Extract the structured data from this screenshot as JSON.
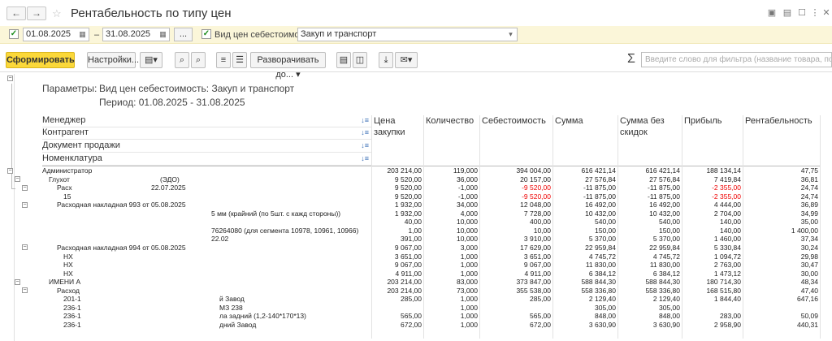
{
  "window": {
    "title": "Рентабельность по типу цен"
  },
  "filters": {
    "date_from": "01.08.2025",
    "date_sep": "–",
    "date_to": "31.08.2025",
    "ellipsis": "...",
    "cost_type_label": "Вид цен себестоимость:",
    "cost_type_value": "Закуп и транспорт"
  },
  "toolbar": {
    "generate": "Сформировать",
    "settings": "Настройки...",
    "expand": "Разворачивать до...",
    "search_placeholder": "Введите слово для фильтра (название товара, покупателя)"
  },
  "report": {
    "params_label": "Параметры:",
    "param_cost": "Вид цен себестоимость: Закуп и транспорт",
    "param_period": "Период: 01.08.2025 - 31.08.2025",
    "group_headers": [
      "Менеджер",
      "Контрагент",
      "Документ продажи",
      "Номенклатура"
    ],
    "columns": {
      "price": "Цена закупки",
      "qty": "Количество",
      "cost": "Себестоимость",
      "sum": "Сумма",
      "sum_no_disc": "Сумма без скидок",
      "profit": "Прибыль",
      "margin": "Рентабельность"
    },
    "rows": [
      {
        "name": "Администратор",
        "price": "203 214,00",
        "qty": "119,000",
        "cost": "394 004,00",
        "sum": "616 421,14",
        "sum_nd": "616 421,14",
        "profit": "188 134,14",
        "margin": "47,75"
      },
      {
        "name": "Глухот",
        "price": "9 520,00",
        "qty": "36,000",
        "cost": "20 157,00",
        "sum": "27 576,84",
        "sum_nd": "27 576,84",
        "profit": "7 419,84",
        "margin": "36,81"
      },
      {
        "name": "Расх",
        "price": "9 520,00",
        "qty": "-1,000",
        "cost": "-9 520,00",
        "sum": "-11 875,00",
        "sum_nd": "-11 875,00",
        "profit": "-2 355,00",
        "margin": "24,74"
      },
      {
        "name": "15",
        "price": "9 520,00",
        "qty": "-1,000",
        "cost": "-9 520,00",
        "sum": "-11 875,00",
        "sum_nd": "-11 875,00",
        "profit": "-2 355,00",
        "margin": "24,74"
      },
      {
        "name": "Расходная накладная 993 от 05.08.2025",
        "price": "1 932,00",
        "qty": "34,000",
        "cost": "12 048,00",
        "sum": "16 492,00",
        "sum_nd": "16 492,00",
        "profit": "4 444,00",
        "margin": "36,89"
      },
      {
        "name": "5 мм (крайний (по 5шт. с кажд стороны))",
        "price": "1 932,00",
        "qty": "4,000",
        "cost": "7 728,00",
        "sum": "10 432,00",
        "sum_nd": "10 432,00",
        "profit": "2 704,00",
        "margin": "34,99"
      },
      {
        "name": "",
        "price": "40,00",
        "qty": "10,000",
        "cost": "400,00",
        "sum": "540,00",
        "sum_nd": "540,00",
        "profit": "140,00",
        "margin": "35,00"
      },
      {
        "name": "76264080 (для сегмента 10978, 10961, 10966)",
        "price": "1,00",
        "qty": "10,000",
        "cost": "10,00",
        "sum": "150,00",
        "sum_nd": "150,00",
        "profit": "140,00",
        "margin": "1 400,00"
      },
      {
        "name": "22.02",
        "price": "391,00",
        "qty": "10,000",
        "cost": "3 910,00",
        "sum": "5 370,00",
        "sum_nd": "5 370,00",
        "profit": "1 460,00",
        "margin": "37,34"
      },
      {
        "name": "Расходная накладная 994 от 05.08.2025",
        "price": "9 067,00",
        "qty": "3,000",
        "cost": "17 629,00",
        "sum": "22 959,84",
        "sum_nd": "22 959,84",
        "profit": "5 330,84",
        "margin": "30,24"
      },
      {
        "name": "НХ",
        "price": "3 651,00",
        "qty": "1,000",
        "cost": "3 651,00",
        "sum": "4 745,72",
        "sum_nd": "4 745,72",
        "profit": "1 094,72",
        "margin": "29,98"
      },
      {
        "name": "НХ",
        "price": "9 067,00",
        "qty": "1,000",
        "cost": "9 067,00",
        "sum": "11 830,00",
        "sum_nd": "11 830,00",
        "profit": "2 763,00",
        "margin": "30,47"
      },
      {
        "name": "НХ",
        "price": "4 911,00",
        "qty": "1,000",
        "cost": "4 911,00",
        "sum": "6 384,12",
        "sum_nd": "6 384,12",
        "profit": "1 473,12",
        "margin": "30,00"
      },
      {
        "name": "ИМЕНИ А",
        "price": "203 214,00",
        "qty": "83,000",
        "cost": "373 847,00",
        "sum": "588 844,30",
        "sum_nd": "588 844,30",
        "profit": "180 714,30",
        "margin": "48,34"
      },
      {
        "name": "Расход",
        "price": "203 214,00",
        "qty": "73,000",
        "cost": "355 538,00",
        "sum": "558 336,80",
        "sum_nd": "558 336,80",
        "profit": "168 515,80",
        "margin": "47,40"
      },
      {
        "name": "201-1",
        "price": "285,00",
        "qty": "1,000",
        "cost": "285,00",
        "sum": "2 129,40",
        "sum_nd": "2 129,40",
        "profit": "1 844,40",
        "margin": "647,16"
      },
      {
        "name": "236-1",
        "price": "",
        "qty": "1,000",
        "cost": "",
        "sum": "305,00",
        "sum_nd": "305,00",
        "profit": "",
        "margin": ""
      },
      {
        "name": "236-1",
        "price": "565,00",
        "qty": "1,000",
        "cost": "565,00",
        "sum": "848,00",
        "sum_nd": "848,00",
        "profit": "283,00",
        "margin": "50,09"
      },
      {
        "name": "236-1",
        "price": "672,00",
        "qty": "1,000",
        "cost": "672,00",
        "sum": "3 630,90",
        "sum_nd": "3 630,90",
        "profit": "2 958,90",
        "margin": "440,31"
      }
    ],
    "row_extra": {
      "r1_suffix": "(ЭДО)",
      "r2_suffix": "22.07.2025",
      "r16_suffix": "й Завод",
      "r17_suffix": "МЗ 238",
      "r18_suffix": "ла задний (1,2-140*170*13)",
      "r19_suffix": "дний Завод"
    }
  }
}
